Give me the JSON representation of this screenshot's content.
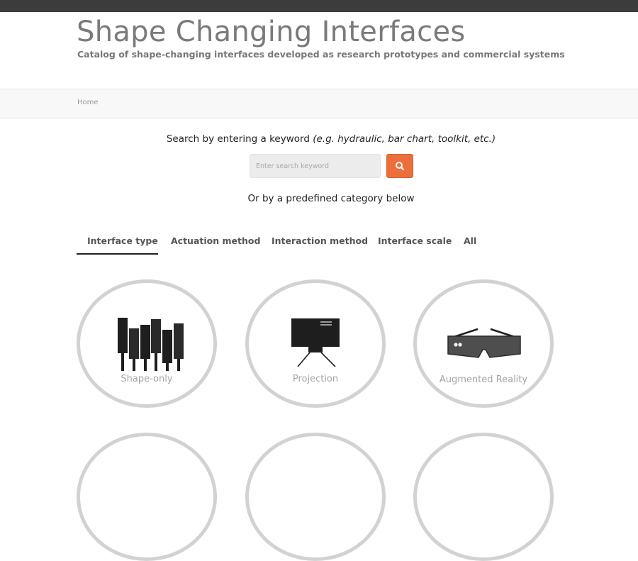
{
  "header": {
    "title": "Shape Changing Interfaces",
    "subtitle": "Catalog of shape-changing interfaces developed as research prototypes and commercial systems"
  },
  "breadcrumb": {
    "home": "Home"
  },
  "search": {
    "prompt": "Search by entering a keyword",
    "examples": "(e.g. hydraulic, bar chart, toolkit, etc.)",
    "placeholder": "Enter search keyword",
    "button_icon": "search-icon"
  },
  "category_prompt": "Or by a predefined category below",
  "tabs": [
    {
      "label": "Interface type",
      "active": true
    },
    {
      "label": "Actuation method",
      "active": false
    },
    {
      "label": "Interaction method",
      "active": false
    },
    {
      "label": "Interface scale",
      "active": false
    },
    {
      "label": "All",
      "active": false
    }
  ],
  "categories": [
    {
      "label": "Shape-only",
      "icon": "pin-array-icon"
    },
    {
      "label": "Projection",
      "icon": "projector-icon"
    },
    {
      "label": "Augmented Reality",
      "icon": "ar-glasses-icon"
    }
  ],
  "colors": {
    "accent": "#ec6e3b",
    "header_bar": "#3c3c3c",
    "circle_border": "#d2d2d2"
  }
}
